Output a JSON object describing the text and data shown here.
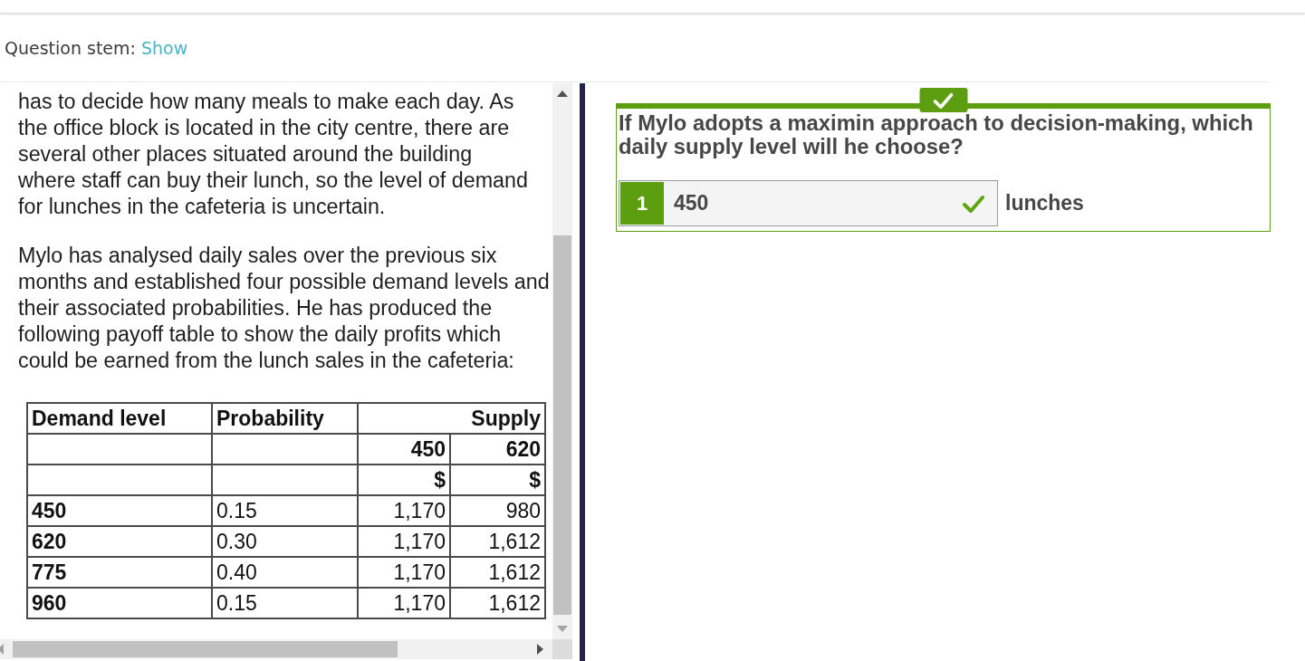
{
  "header": {
    "label": "Question stem:",
    "link": "Show"
  },
  "scenario": {
    "paragraphs": [
      "has to decide how many meals to make each day. As the office block is located in the city centre, there are several other places situated around the building where staff can buy their lunch, so the level of demand for lunches in the cafeteria is uncertain.",
      "Mylo has analysed daily sales over the previous six months and established four possible demand levels and their associated probabilities. He has produced the following payoff table to show the daily profits which could be earned from the lunch sales in the cafeteria:"
    ],
    "table": {
      "columns": [
        "Demand level",
        "Probability"
      ],
      "group_header": "Supply",
      "supply_levels": [
        "450",
        "620"
      ],
      "units": [
        "$",
        "$"
      ],
      "rows": [
        {
          "demand": "450",
          "probability": "0.15",
          "payoffs": [
            "1,170",
            "980"
          ]
        },
        {
          "demand": "620",
          "probability": "0.30",
          "payoffs": [
            "1,170",
            "1,612"
          ]
        },
        {
          "demand": "775",
          "probability": "0.40",
          "payoffs": [
            "1,170",
            "1,612"
          ]
        },
        {
          "demand": "960",
          "probability": "0.15",
          "payoffs": [
            "1,170",
            "1,612"
          ]
        }
      ]
    }
  },
  "question": {
    "correct": true,
    "text": "If Mylo adopts a maximin approach to decision-making, which daily supply level will he choose?",
    "answers": [
      {
        "number": "1",
        "value": "450",
        "unit": "lunches",
        "correct": true
      }
    ]
  }
}
